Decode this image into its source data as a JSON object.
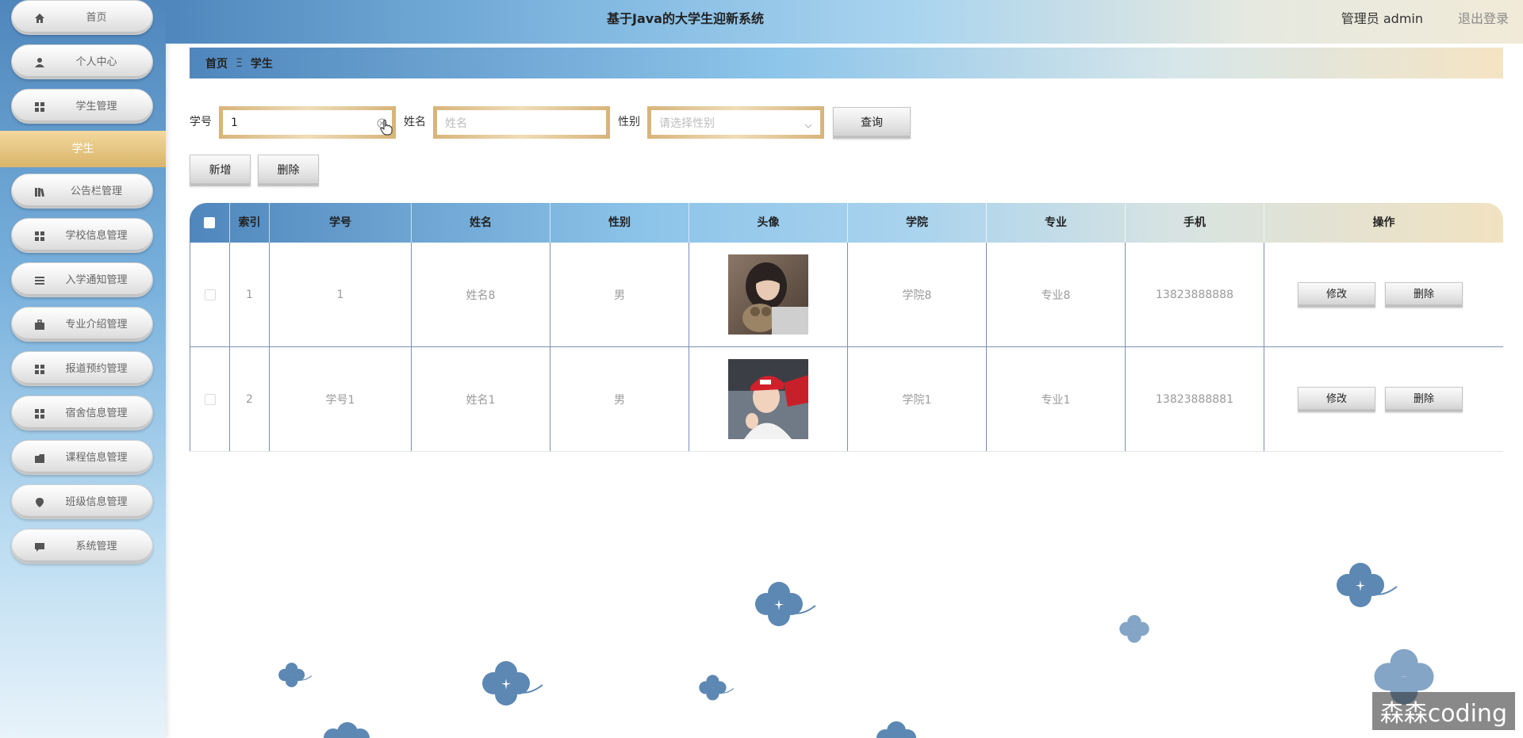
{
  "header": {
    "title": "基于Java的大学生迎新系统",
    "user": "管理员 admin",
    "logout": "退出登录"
  },
  "sidebar": {
    "items": [
      {
        "label": "首页",
        "icon": "home-icon"
      },
      {
        "label": "个人中心",
        "icon": "user-icon"
      },
      {
        "label": "学生管理",
        "icon": "grid-icon"
      },
      {
        "label": "公告栏管理",
        "icon": "bookshelf-icon"
      },
      {
        "label": "学校信息管理",
        "icon": "grid-icon"
      },
      {
        "label": "入学通知管理",
        "icon": "list-icon"
      },
      {
        "label": "专业介绍管理",
        "icon": "briefcase-icon"
      },
      {
        "label": "报道预约管理",
        "icon": "grid-icon"
      },
      {
        "label": "宿舍信息管理",
        "icon": "grid-icon"
      },
      {
        "label": "课程信息管理",
        "icon": "folder-icon"
      },
      {
        "label": "班级信息管理",
        "icon": "location-pin-icon"
      },
      {
        "label": "系统管理",
        "icon": "chat-icon"
      }
    ],
    "active_sub": "学生"
  },
  "breadcrumb": {
    "home": "首页",
    "separator": "Ξ",
    "current": "学生"
  },
  "search": {
    "xuehao_label": "学号",
    "xuehao_value": "1",
    "name_label": "姓名",
    "name_placeholder": "姓名",
    "gender_label": "性别",
    "gender_placeholder": "请选择性别",
    "query_button": "查询"
  },
  "actions": {
    "add": "新增",
    "delete": "删除"
  },
  "table": {
    "columns": [
      "索引",
      "学号",
      "姓名",
      "性别",
      "头像",
      "学院",
      "专业",
      "手机",
      "操作"
    ],
    "rows": [
      {
        "index": "1",
        "xuehao": "1",
        "name": "姓名8",
        "gender": "男",
        "college": "学院8",
        "major": "专业8",
        "phone": "13823888888",
        "edit": "修改",
        "remove": "删除"
      },
      {
        "index": "2",
        "xuehao": "学号1",
        "name": "姓名1",
        "gender": "男",
        "college": "学院1",
        "major": "专业1",
        "phone": "13823888881",
        "edit": "修改",
        "remove": "删除"
      }
    ]
  },
  "watermark": "森森coding",
  "colors": {
    "primary_blue": "#4f87bd",
    "gold": "#d7b47a",
    "flower": "#5c88b3"
  }
}
